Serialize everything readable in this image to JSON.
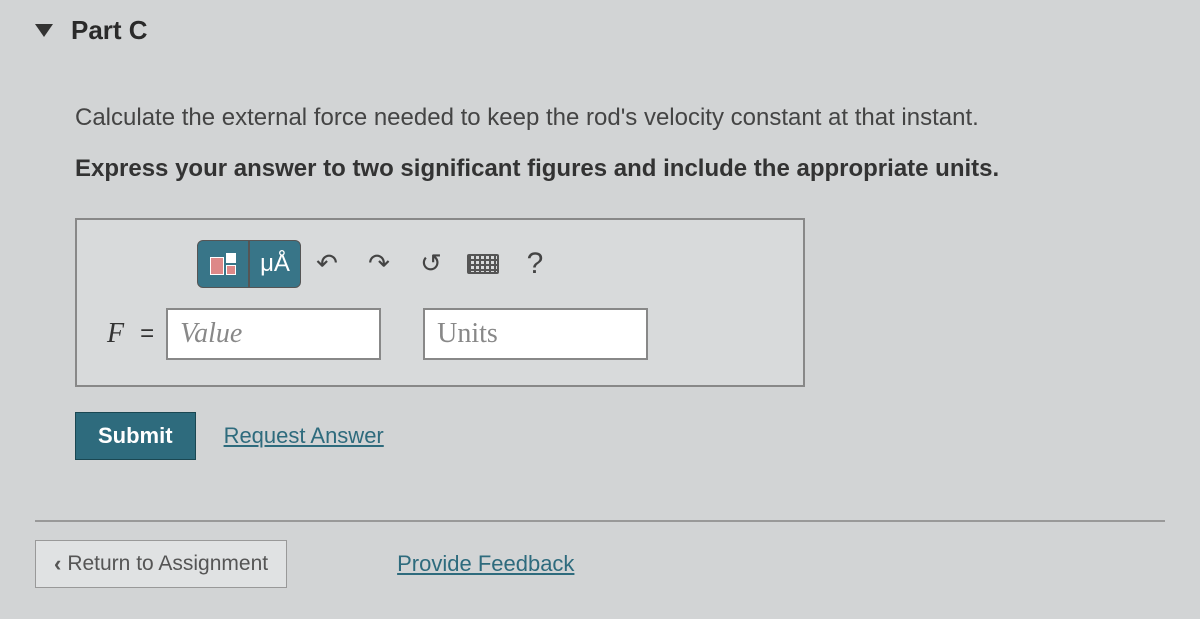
{
  "part": {
    "title": "Part C"
  },
  "question": {
    "text": "Calculate the external force needed to keep the rod's velocity constant at that instant.",
    "instruction": "Express your answer to two significant figures and include the appropriate units."
  },
  "answer": {
    "variable": "F",
    "equals": "=",
    "value_placeholder": "Value",
    "units_placeholder": "Units",
    "special_chars_label": "μÅ",
    "help_label": "?"
  },
  "actions": {
    "submit_label": "Submit",
    "request_answer_label": "Request Answer",
    "return_label": "Return to Assignment",
    "feedback_label": "Provide Feedback"
  }
}
